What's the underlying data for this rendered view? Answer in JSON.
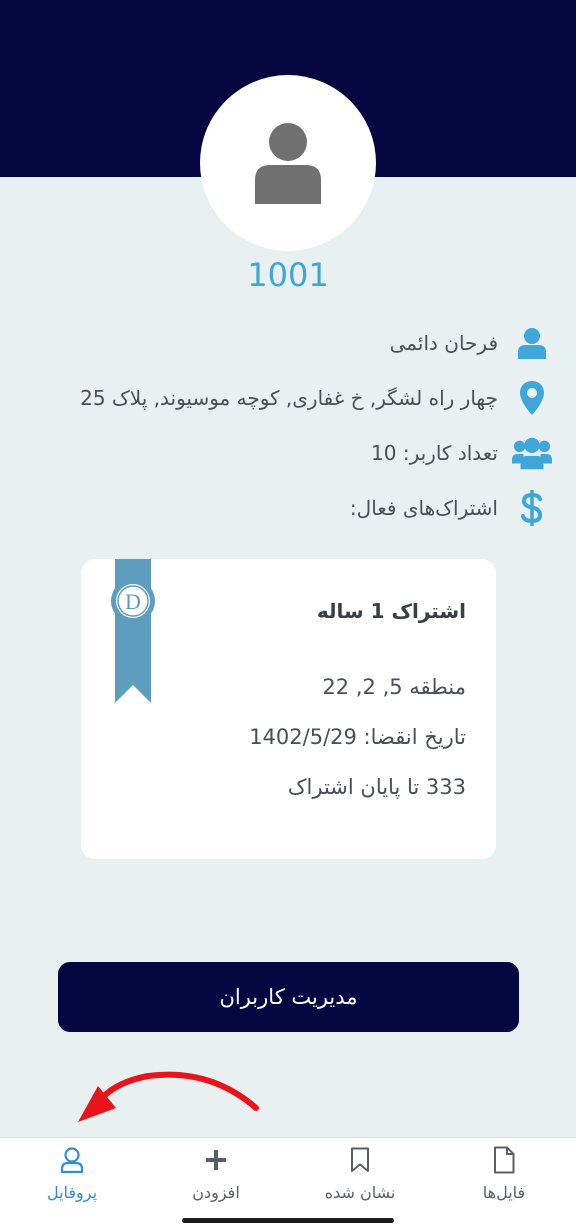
{
  "profile": {
    "user_code": "1001",
    "name": "فرحان دائمی",
    "address": "چهار راه لشگر, خ غفاری, کوچه موسیوند, پلاک 25",
    "user_count": "تعداد کاربر: 10",
    "active_subscriptions_label": "اشتراک‌های فعال:"
  },
  "subscription_card": {
    "title_prefix": "اشتراک",
    "title_number": "1",
    "title_suffix": "ساله",
    "badge_letter": "D",
    "regions": "منطقه 5, 2, 22",
    "expiry": "تاریخ انقضا: 1402/5/29",
    "remaining": "333 تا پایان اشتراک"
  },
  "actions": {
    "manage_users_label": "مدیریت کاربران"
  },
  "tabs": [
    {
      "label": "پروفایل",
      "icon": "user-icon",
      "active": true
    },
    {
      "label": "افزودن",
      "icon": "plus-icon",
      "active": false
    },
    {
      "label": "نشان شده",
      "icon": "bookmark-icon",
      "active": false
    },
    {
      "label": "فایل‌ها",
      "icon": "file-icon",
      "active": false
    }
  ],
  "colors": {
    "header": "#05053f",
    "accent": "#3ea6d8",
    "background": "#e8f0f1",
    "ribbon": "#5e9dbd",
    "annotation_arrow": "#e8141a"
  }
}
